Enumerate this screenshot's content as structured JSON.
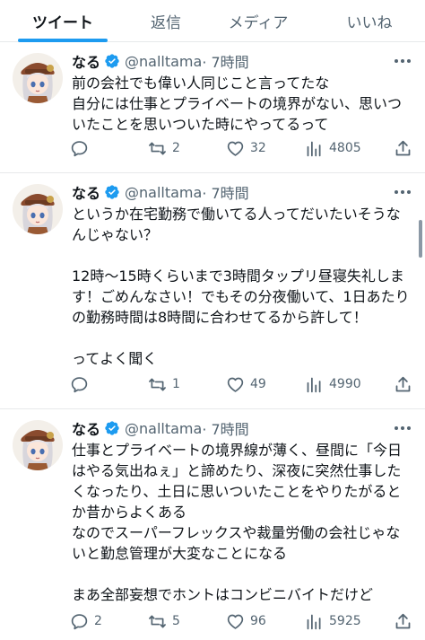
{
  "tabs": [
    {
      "label": "ツイート",
      "active": true
    },
    {
      "label": "返信",
      "active": false
    },
    {
      "label": "メディア",
      "active": false
    },
    {
      "label": "いいね",
      "active": false
    }
  ],
  "accent_color": "#1d9bf0",
  "tweets": [
    {
      "name": "なる",
      "handle": "@nalltama",
      "time": "· 7時間",
      "verified": true,
      "text": "前の会社でも偉い人同じこと言ってたな\n自分には仕事とプライベートの境界がない、思いついたことを思いついた時にやってるって",
      "replies": "",
      "retweets": "2",
      "likes": "32",
      "views": "4805"
    },
    {
      "name": "なる",
      "handle": "@nalltama",
      "time": "· 7時間",
      "verified": true,
      "text": "というか在宅勤務で働いてる人ってだいたいそうなんじゃない？\n\n12時〜15時くらいまで3時間タップリ昼寝失礼します！ごめんなさい！でもその分夜働いて、1日あたりの勤務時間は8時間に合わせてるから許して！\n\nってよく聞く",
      "replies": "",
      "retweets": "1",
      "likes": "49",
      "views": "4990"
    },
    {
      "name": "なる",
      "handle": "@nalltama",
      "time": "· 7時間",
      "verified": true,
      "text": "仕事とプライベートの境界線が薄く、昼間に「今日はやる気出ねぇ」と諦めたり、深夜に突然仕事したくなったり、土日に思いついたことをやりたがるとか昔からよくある\nなのでスーパーフレックスや裁量労働の会社じゃないと勤怠管理が大変なことになる\n\nまあ全部妄想でホントはコンビニバイトだけど",
      "replies": "2",
      "retweets": "5",
      "likes": "96",
      "views": "5925"
    }
  ]
}
